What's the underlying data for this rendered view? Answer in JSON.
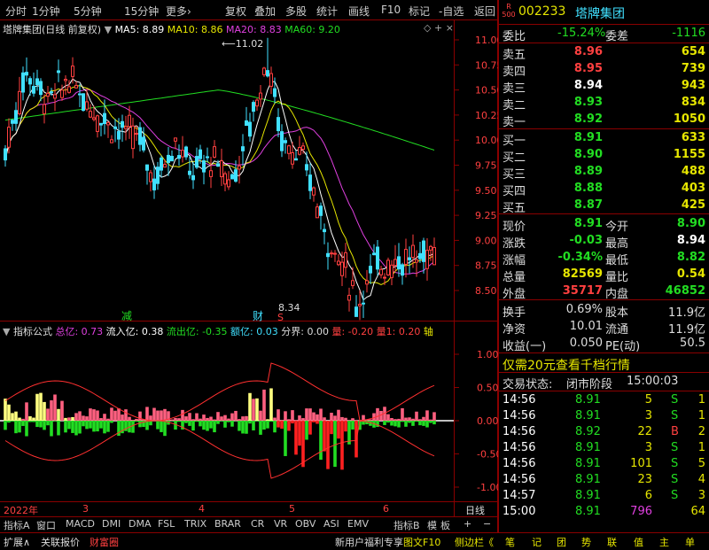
{
  "toolbar": {
    "items": [
      "分时",
      "1分钟",
      "5分钟",
      "15分钟",
      "更多›",
      "复权",
      "叠加",
      "多股",
      "统计",
      "画线",
      "F10",
      "标记",
      "-自选",
      "返回"
    ]
  },
  "chart_header": {
    "title": "塔牌集团(日线 前复权)",
    "ma5": "MA5: 8.89",
    "ma10": "MA10: 8.86",
    "ma20": "MA20: 8.83",
    "ma60": "MA60: 9.20",
    "high_label": "11.02",
    "low_label": "8.34"
  },
  "price_axis": [
    "11.00",
    "10.75",
    "10.50",
    "10.25",
    "10.00",
    "9.75",
    "9.50",
    "9.25",
    "9.00",
    "8.75",
    "8.50"
  ],
  "markers": {
    "jian": "减",
    "cai": "财",
    "s": "S"
  },
  "indicator_header": {
    "name": "指标公式",
    "zongyi": "总亿: 0.73",
    "liuru": "流入亿: 0.38",
    "liuchu": "流出亿: -0.35",
    "eyi": "额亿: 0.03",
    "fenjie": "分界: 0.00",
    "liang": "量: -0.20",
    "liang1": "量1: 0.20",
    "zhou": "轴"
  },
  "indicator_axis": [
    "1.00",
    "0.50",
    "0.00",
    "-0.50",
    "-1.00"
  ],
  "date_axis": {
    "start": "2022年",
    "m3": "3",
    "m4": "4",
    "m5": "5",
    "m6": "6",
    "period": "日线"
  },
  "tabs": [
    "指标A",
    "窗口",
    "MACD",
    "DMI",
    "DMA",
    "FSL",
    "TRIX",
    "BRAR",
    "CR",
    "VR",
    "OBV",
    "ASI",
    "EMV",
    "指标B",
    "模",
    "板",
    "+",
    "−"
  ],
  "bottom": {
    "left": [
      "扩展∧",
      "关联报价",
      "财富圈"
    ],
    "right": [
      "新用户福利专享",
      "图文F10",
      "侧边栏《"
    ],
    "icons": [
      "笔",
      "记",
      "团",
      "势",
      "联",
      "值",
      "主",
      "单"
    ]
  },
  "quote": {
    "code": "002233",
    "name": "塔牌集团",
    "r_badge": "R",
    "r_num": "500",
    "weibi_label": "委比",
    "weibi": "-15.24%",
    "weicha_label": "委差",
    "weicha": "-1116",
    "asks": [
      {
        "label": "卖五",
        "price": "8.96",
        "vol": "654"
      },
      {
        "label": "卖四",
        "price": "8.95",
        "vol": "739"
      },
      {
        "label": "卖三",
        "price": "8.94",
        "vol": "943"
      },
      {
        "label": "卖二",
        "price": "8.93",
        "vol": "834"
      },
      {
        "label": "卖一",
        "price": "8.92",
        "vol": "1050"
      }
    ],
    "bids": [
      {
        "label": "买一",
        "price": "8.91",
        "vol": "633"
      },
      {
        "label": "买二",
        "price": "8.90",
        "vol": "1155"
      },
      {
        "label": "买三",
        "price": "8.89",
        "vol": "488"
      },
      {
        "label": "买四",
        "price": "8.88",
        "vol": "403"
      },
      {
        "label": "买五",
        "price": "8.87",
        "vol": "425"
      }
    ],
    "stats": [
      {
        "l1": "现价",
        "v1": "8.91",
        "l2": "今开",
        "v2": "8.90"
      },
      {
        "l1": "涨跌",
        "v1": "-0.03",
        "l2": "最高",
        "v2": "8.94"
      },
      {
        "l1": "涨幅",
        "v1": "-0.34%",
        "l2": "最低",
        "v2": "8.82"
      },
      {
        "l1": "总量",
        "v1": "82569",
        "l2": "量比",
        "v2": "0.54"
      },
      {
        "l1": "外盘",
        "v1": "35717",
        "l2": "内盘",
        "v2": "46852"
      }
    ],
    "fin": [
      {
        "l1": "换手",
        "v1": "0.69%",
        "l2": "股本",
        "v2": "11.9亿"
      },
      {
        "l1": "净资",
        "v1": "10.01",
        "l2": "流通",
        "v2": "11.9亿"
      },
      {
        "l1": "收益(一)",
        "v1": "0.050",
        "l2": "PE(动)",
        "v2": "50.5"
      }
    ],
    "promo": "仅需20元查看千档行情",
    "status_label": "交易状态:",
    "status_value": "闭市阶段",
    "status_time": "15:00:03",
    "ticks": [
      {
        "t": "14:56",
        "p": "8.91",
        "v": "5",
        "s": "S",
        "n": "1"
      },
      {
        "t": "14:56",
        "p": "8.91",
        "v": "3",
        "s": "S",
        "n": "1"
      },
      {
        "t": "14:56",
        "p": "8.92",
        "v": "22",
        "s": "B",
        "n": "2"
      },
      {
        "t": "14:56",
        "p": "8.91",
        "v": "3",
        "s": "S",
        "n": "1"
      },
      {
        "t": "14:56",
        "p": "8.91",
        "v": "101",
        "s": "S",
        "n": "5"
      },
      {
        "t": "14:56",
        "p": "8.91",
        "v": "23",
        "s": "S",
        "n": "4"
      },
      {
        "t": "14:57",
        "p": "8.91",
        "v": "6",
        "s": "S",
        "n": "3"
      },
      {
        "t": "15:00",
        "p": "8.91",
        "v": "796",
        "s": "",
        "n": "64"
      }
    ]
  }
}
